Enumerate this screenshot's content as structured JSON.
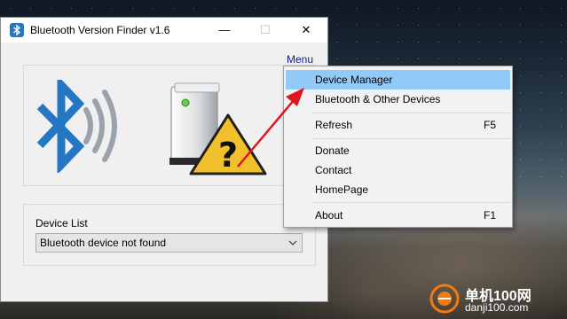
{
  "window": {
    "title": "Bluetooth Version Finder v1.6",
    "controls": {
      "minimize": "—",
      "maximize": "☐",
      "close": "✕"
    }
  },
  "menu_link": "Menu",
  "device_list": {
    "label": "Device List",
    "selected": "Bluetooth device not found"
  },
  "context_menu": {
    "items": [
      {
        "label": "Device Manager",
        "shortcut": "",
        "highlighted": true
      },
      {
        "label": "Bluetooth & Other Devices",
        "shortcut": ""
      },
      {
        "label": "Refresh",
        "shortcut": "F5"
      },
      {
        "label": "Donate",
        "shortcut": ""
      },
      {
        "label": "Contact",
        "shortcut": ""
      },
      {
        "label": "HomePage",
        "shortcut": ""
      },
      {
        "label": "About",
        "shortcut": "F1"
      }
    ]
  },
  "graphics": {
    "bluetooth_icon": "bluetooth-icon",
    "warning_icon": "warning-question-icon",
    "colors": {
      "bluetooth_blue": "#2577c4",
      "warning_yellow": "#f2c02c",
      "highlight": "#91c9f7",
      "arrow_red": "#e0141e"
    }
  },
  "watermark": {
    "name": "单机100网",
    "url": "danji100.com"
  }
}
